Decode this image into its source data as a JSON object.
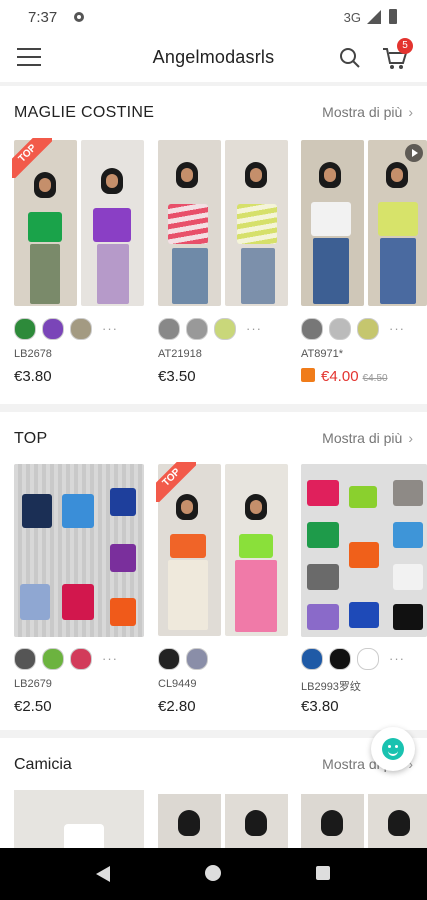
{
  "status": {
    "time": "7:37",
    "network": "3G"
  },
  "app": {
    "title": "Angelmodasrls",
    "cart_count": "5"
  },
  "sections": [
    {
      "title": "MAGLIE COSTINE",
      "more": "Mostra di più",
      "items": [
        {
          "code": "LB2678",
          "price": "€3.80",
          "old_price": "",
          "sale": false,
          "tag": "TOP",
          "swatches": [
            "#2d8a3a",
            "#7a45b8",
            "#a39a82"
          ]
        },
        {
          "code": "AT21918",
          "price": "€3.50",
          "old_price": "",
          "sale": false,
          "tag": "",
          "swatches": [
            "#888",
            "#999",
            "#c9d77a"
          ]
        },
        {
          "code": "AT8971*",
          "price": "€4.00",
          "old_price": "€4.50",
          "sale": true,
          "tag": "",
          "swatches": [
            "#777",
            "#bbb",
            "#c5c66e"
          ]
        }
      ]
    },
    {
      "title": "TOP",
      "more": "Mostra di più",
      "items": [
        {
          "code": "LB2679",
          "price": "€2.50",
          "old_price": "",
          "sale": false,
          "tag": "",
          "swatches": [
            "#555",
            "#6cb33f",
            "#d23b5a"
          ]
        },
        {
          "code": "CL9449",
          "price": "€2.80",
          "old_price": "",
          "sale": false,
          "tag": "TOP",
          "swatches": [
            "#222",
            "#8a8ea8"
          ]
        },
        {
          "code": "LB2993罗纹",
          "price": "€3.80",
          "old_price": "",
          "sale": false,
          "tag": "",
          "swatches": [
            "#1f5aa6",
            "#111",
            "#fff"
          ]
        }
      ]
    },
    {
      "title": "Camicia",
      "more": "Mostra di più"
    }
  ],
  "icons": {
    "menu": "menu-icon",
    "search": "search-icon",
    "cart": "cart-icon",
    "chat": "chat-icon"
  }
}
